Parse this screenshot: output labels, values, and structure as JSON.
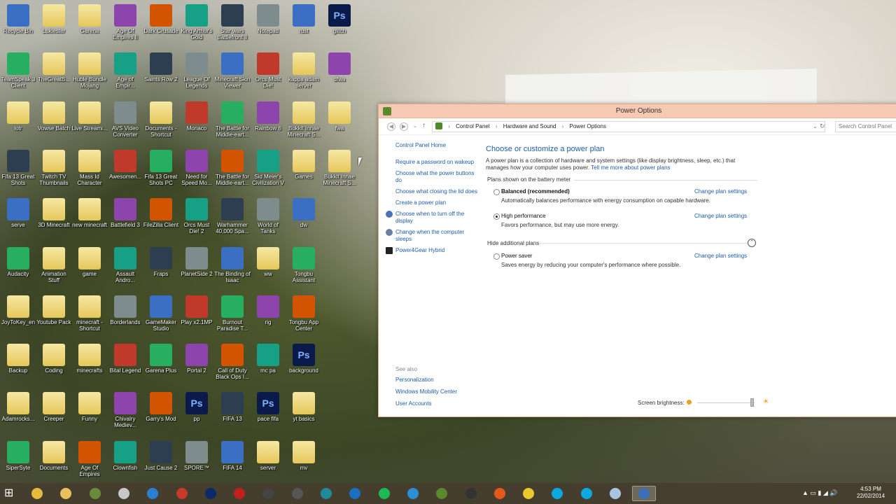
{
  "desktop_icons": [
    {
      "label": "Recycle Bin",
      "icon": "recycle-bin-icon"
    },
    {
      "label": "Lukiester",
      "icon": "folder-icon"
    },
    {
      "label": "Garena",
      "icon": "folder-icon"
    },
    {
      "label": "Age Of Empires II",
      "icon": "age-of-empires-icon"
    },
    {
      "label": "Dark Crusade",
      "icon": "game-icon"
    },
    {
      "label": "King Arthur's Gold",
      "icon": "game-icon"
    },
    {
      "label": "Star wars Battlefront II",
      "icon": "game-icon"
    },
    {
      "label": "Notepad",
      "icon": "notepad-icon"
    },
    {
      "label": "rust",
      "icon": "file-icon"
    },
    {
      "label": "glitch",
      "icon": "photoshop-file-icon"
    },
    {
      "label": "TeamSpeak 3 Client",
      "icon": "teamspeak-icon"
    },
    {
      "label": "TheGreatB...",
      "icon": "folder-icon"
    },
    {
      "label": "Huble Bundle Mojang",
      "icon": "folder-icon"
    },
    {
      "label": "Age of Empir...",
      "icon": "age-of-empires-icon"
    },
    {
      "label": "Saints Row 2",
      "icon": "game-icon"
    },
    {
      "label": "League Of Legends",
      "icon": "game-icon"
    },
    {
      "label": "Minecraft Skin Viewer",
      "icon": "minecraft-icon"
    },
    {
      "label": "Orcs Must Die!",
      "icon": "game-icon"
    },
    {
      "label": "kappa adam server",
      "icon": "folder-icon"
    },
    {
      "label": "dfwa",
      "icon": "file-icon"
    },
    {
      "label": "lotr",
      "icon": "folder-icon"
    },
    {
      "label": "Vowse Batch",
      "icon": "folder-icon"
    },
    {
      "label": "Live Streami...",
      "icon": "folder-icon"
    },
    {
      "label": "AVS Video Converter",
      "icon": "video-converter-icon"
    },
    {
      "label": "Documents - Shortcut",
      "icon": "folder-icon"
    },
    {
      "label": "Monaco",
      "icon": "game-icon"
    },
    {
      "label": "The Battle for Middle-eart...",
      "icon": "game-icon"
    },
    {
      "label": "Rainbow 6",
      "icon": "game-icon"
    },
    {
      "label": "Bukkit Innae Minecraft S...",
      "icon": "folder-icon"
    },
    {
      "label": "fwa",
      "icon": "folder-icon"
    },
    {
      "label": "Fifa 13 Great Shots",
      "icon": "video-icon"
    },
    {
      "label": "Twitch TV Thumbnails",
      "icon": "folder-icon"
    },
    {
      "label": "Mass Id Character",
      "icon": "folder-icon"
    },
    {
      "label": "Awesomen...",
      "icon": "game-icon"
    },
    {
      "label": "Fifa 13 Great Shots PC",
      "icon": "video-icon"
    },
    {
      "label": "Need for Speed Mo...",
      "icon": "game-icon"
    },
    {
      "label": "The Battle for Middle-eart...",
      "icon": "game-icon"
    },
    {
      "label": "Sid Meier's Civilization V",
      "icon": "game-icon"
    },
    {
      "label": "Games",
      "icon": "folder-icon"
    },
    {
      "label": "Bukkit Innae Minecraft S...",
      "icon": "folder-icon"
    },
    {
      "label": "serve",
      "icon": "file-icon"
    },
    {
      "label": "3D Minecraft",
      "icon": "folder-icon"
    },
    {
      "label": "new minecraft",
      "icon": "folder-icon"
    },
    {
      "label": "Battlefield 3",
      "icon": "game-icon"
    },
    {
      "label": "FileZilla Client",
      "icon": "filezilla-icon"
    },
    {
      "label": "Orcs Must Die! 2",
      "icon": "game-icon"
    },
    {
      "label": "Warhammer 40,000 Spa...",
      "icon": "game-icon"
    },
    {
      "label": "World of Tanks",
      "icon": "game-icon"
    },
    {
      "label": "dw",
      "icon": "file-icon"
    },
    {
      "label": "",
      "icon": ""
    },
    {
      "label": "Audacity",
      "icon": "audacity-icon"
    },
    {
      "label": "Animation Stuff",
      "icon": "folder-icon"
    },
    {
      "label": "game",
      "icon": "folder-icon"
    },
    {
      "label": "Assault Andro...",
      "icon": "game-icon"
    },
    {
      "label": "Fraps",
      "icon": "fraps-icon"
    },
    {
      "label": "PlanetSide 2",
      "icon": "game-icon"
    },
    {
      "label": "The Binding of Isaac",
      "icon": "game-icon"
    },
    {
      "label": "ww",
      "icon": "folder-icon"
    },
    {
      "label": "Tongbu Assistant",
      "icon": "tongbu-icon"
    },
    {
      "label": "",
      "icon": ""
    },
    {
      "label": "JoyToKey_en",
      "icon": "folder-icon"
    },
    {
      "label": "Youtube Pack",
      "icon": "folder-icon"
    },
    {
      "label": "minecraft - Shortcut",
      "icon": "folder-icon"
    },
    {
      "label": "Borderlands",
      "icon": "game-icon"
    },
    {
      "label": "GameMaker Studio",
      "icon": "gamemaker-icon"
    },
    {
      "label": "Play x2.1MP",
      "icon": "file-icon"
    },
    {
      "label": "Burnout Paradise T...",
      "icon": "game-icon"
    },
    {
      "label": "rig",
      "icon": "file-icon"
    },
    {
      "label": "Tongbu App Center",
      "icon": "tongbu-icon"
    },
    {
      "label": "",
      "icon": ""
    },
    {
      "label": "Backup",
      "icon": "folder-icon"
    },
    {
      "label": "Coding",
      "icon": "folder-icon"
    },
    {
      "label": "minecrafts",
      "icon": "folder-icon"
    },
    {
      "label": "Bital Legend",
      "icon": "game-icon"
    },
    {
      "label": "Garena Plus",
      "icon": "garena-icon"
    },
    {
      "label": "Portal 2",
      "icon": "game-icon"
    },
    {
      "label": "Call of Duty Black Ops I...",
      "icon": "game-icon"
    },
    {
      "label": "mc pa",
      "icon": "file-icon"
    },
    {
      "label": "background",
      "icon": "photoshop-file-icon"
    },
    {
      "label": "",
      "icon": ""
    },
    {
      "label": "Adamrocks...",
      "icon": "folder-icon"
    },
    {
      "label": "Creeper",
      "icon": "folder-icon"
    },
    {
      "label": "Funny",
      "icon": "folder-icon"
    },
    {
      "label": "Chivalry Mediev...",
      "icon": "game-icon"
    },
    {
      "label": "Garry's Mod",
      "icon": "game-icon"
    },
    {
      "label": "pp",
      "icon": "photoshop-file-icon"
    },
    {
      "label": "FIFA 13",
      "icon": "game-icon"
    },
    {
      "label": "pace fifa",
      "icon": "photoshop-file-icon"
    },
    {
      "label": "yt basics",
      "icon": "folder-icon"
    },
    {
      "label": "",
      "icon": ""
    },
    {
      "label": "SiperSyte",
      "icon": "file-icon"
    },
    {
      "label": "Documents",
      "icon": "folder-icon"
    },
    {
      "label": "Age Of Empires",
      "icon": "age-of-empires-icon"
    },
    {
      "label": "Clownfish",
      "icon": "clownfish-icon"
    },
    {
      "label": "Just Cause 2",
      "icon": "game-icon"
    },
    {
      "label": "SPORE™",
      "icon": "game-icon"
    },
    {
      "label": "FIFA 14",
      "icon": "game-icon"
    },
    {
      "label": "server",
      "icon": "folder-icon"
    },
    {
      "label": "mv",
      "icon": "folder-icon"
    },
    {
      "label": "",
      "icon": ""
    }
  ],
  "window": {
    "title": "Power Options",
    "breadcrumb": [
      "Control Panel",
      "Hardware and Sound",
      "Power Options"
    ],
    "search_placeholder": "Search Control Panel",
    "sidebar": {
      "home": "Control Panel Home",
      "links": [
        "Require a password on wakeup",
        "Choose what the power buttons do",
        "Choose what closing the lid does",
        "Create a power plan",
        "Choose when to turn off the display",
        "Change when the computer sleeps",
        "Power4Gear Hybrid"
      ],
      "see_also_heading": "See also",
      "see_also": [
        "Personalization",
        "Windows Mobility Center",
        "User Accounts"
      ]
    },
    "main": {
      "heading": "Choose or customize a power plan",
      "description": "A power plan is a collection of hardware and system settings (like display brightness, sleep, etc.) that manages how your computer uses power.",
      "tell_me_link": "Tell me more about power plans",
      "plans_heading": "Plans shown on the battery meter",
      "plans": [
        {
          "name": "Balanced (recommended)",
          "desc": "Automatically balances performance with energy consumption on capable hardware.",
          "selected": false,
          "change": "Change plan settings"
        },
        {
          "name": "High performance",
          "desc": "Favors performance, but may use more energy.",
          "selected": true,
          "change": "Change plan settings"
        }
      ],
      "hide_label": "Hide additional plans",
      "additional_plans": [
        {
          "name": "Power saver",
          "desc": "Saves energy by reducing your computer's performance where possible.",
          "selected": false,
          "change": "Change plan settings"
        }
      ],
      "brightness_label": "Screen brightness:",
      "brightness_level": 0.95
    }
  },
  "taskbar": {
    "apps": [
      "chrome-icon",
      "file-explorer-icon",
      "minecraft-icon",
      "notepad-icon",
      "media-player-icon",
      "filezilla-icon",
      "photoshop-icon",
      "flash-icon",
      "obs-icon",
      "assassins-creed-icon",
      "maya-icon",
      "teamspeak-icon",
      "spotify-icon",
      "itunes-icon",
      "minecraft-block-icon",
      "steam-icon",
      "origin-icon",
      "nuclear-icon",
      "skype-icon",
      "skype-icon",
      "notepad-icon",
      "control-panel-icon"
    ],
    "clock_time": "4:53 PM",
    "clock_date": "22/02/2014"
  }
}
